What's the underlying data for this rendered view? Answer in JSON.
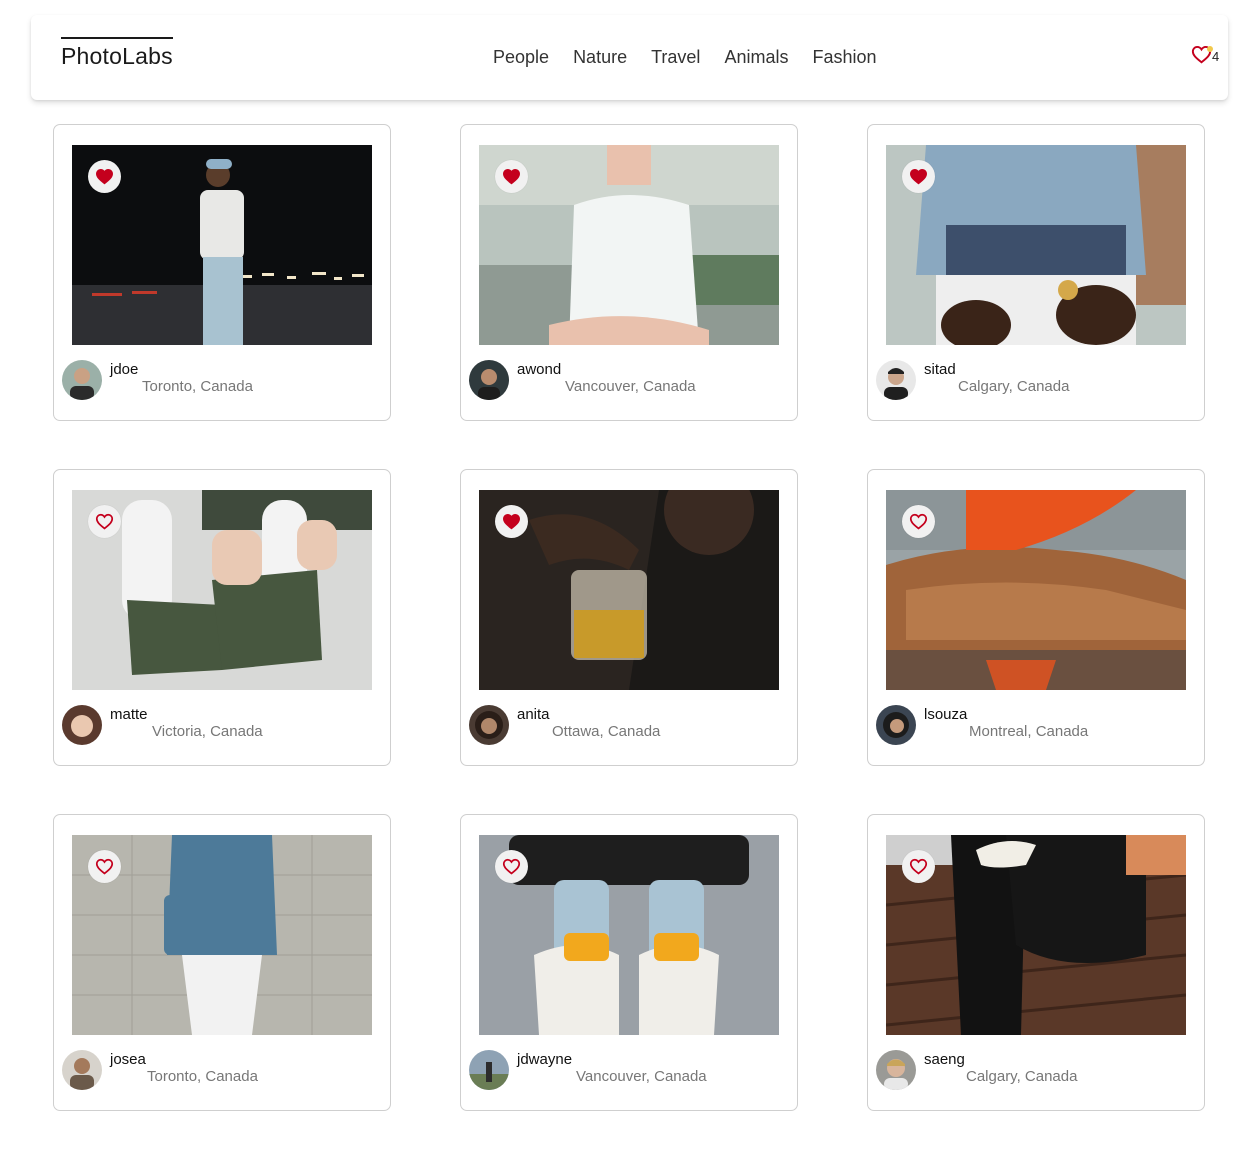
{
  "app": {
    "logo": "PhotoLabs",
    "topics": [
      "People",
      "Nature",
      "Travel",
      "Animals",
      "Fashion"
    ],
    "favourites_count": "4",
    "accent_color": "#c4001d"
  },
  "photos": [
    {
      "username": "jdoe",
      "location": "Toronto, Canada",
      "favourited": true
    },
    {
      "username": "awond",
      "location": "Vancouver, Canada",
      "favourited": true
    },
    {
      "username": "sitad",
      "location": "Calgary, Canada",
      "favourited": true
    },
    {
      "username": "matte",
      "location": "Victoria, Canada",
      "favourited": false
    },
    {
      "username": "anita",
      "location": "Ottawa, Canada",
      "favourited": true
    },
    {
      "username": "lsouza",
      "location": "Montreal, Canada",
      "favourited": false
    },
    {
      "username": "josea",
      "location": "Toronto, Canada",
      "favourited": false
    },
    {
      "username": "jdwayne",
      "location": "Vancouver, Canada",
      "favourited": false
    },
    {
      "username": "saeng",
      "location": "Calgary, Canada",
      "favourited": false
    }
  ]
}
